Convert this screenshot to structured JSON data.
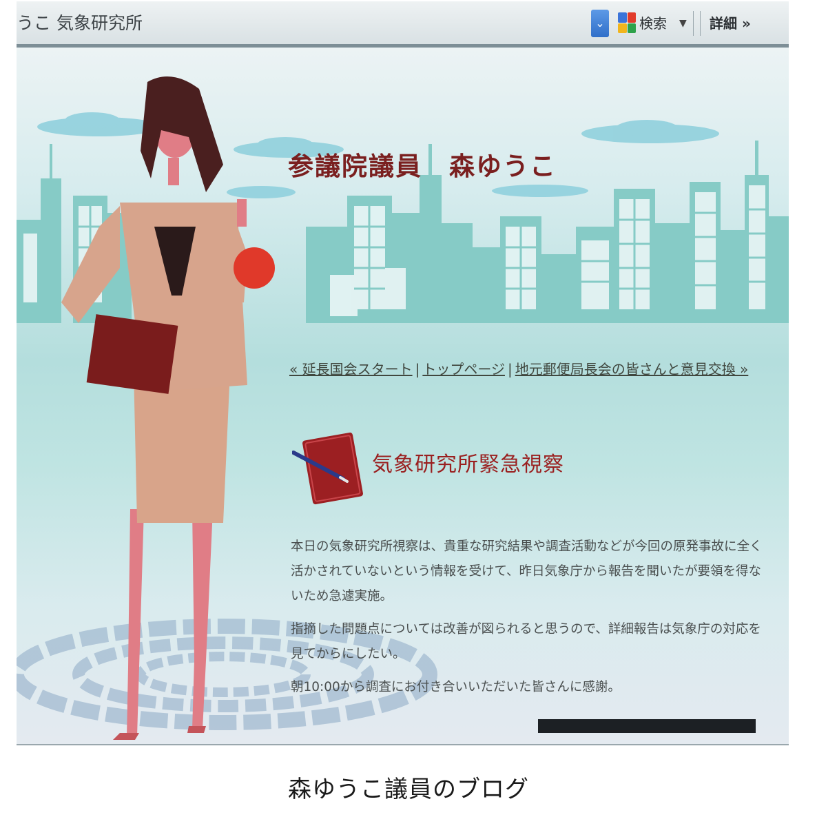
{
  "toolbar": {
    "address_text": "うこ 気象研究所",
    "search_label": "検索",
    "search_caret": "▼",
    "detail_label": "詳細 »"
  },
  "blog": {
    "title": "参議院議員　森ゆうこ",
    "nav": {
      "prev": "« 延長国会スタート",
      "top": "トップページ",
      "next": "地元郵便局長会の皆さんと意見交換 »",
      "separator": "|"
    },
    "entry": {
      "title": "気象研究所緊急視察",
      "paragraphs": [
        "本日の気象研究所視察は、貴重な研究結果や調査活動などが今回の原発事故に全く活かされていないという情報を受けて、昨日気象庁から報告を聞いたが要領を得ないため急遽実施。",
        "指摘した問題点については改善が図られると思うので、詳細報告は気象庁の対応を見てからにしたい。",
        "朝10:00から調査にお付き合いいただいた皆さんに感謝。"
      ]
    }
  },
  "caption": "森ゆうこ議員のブログ",
  "colors": {
    "title": "#7a1f1f",
    "entry_title": "#9a1f1f",
    "building": "#86cbc6",
    "sky_background": "#dfe8ea"
  }
}
